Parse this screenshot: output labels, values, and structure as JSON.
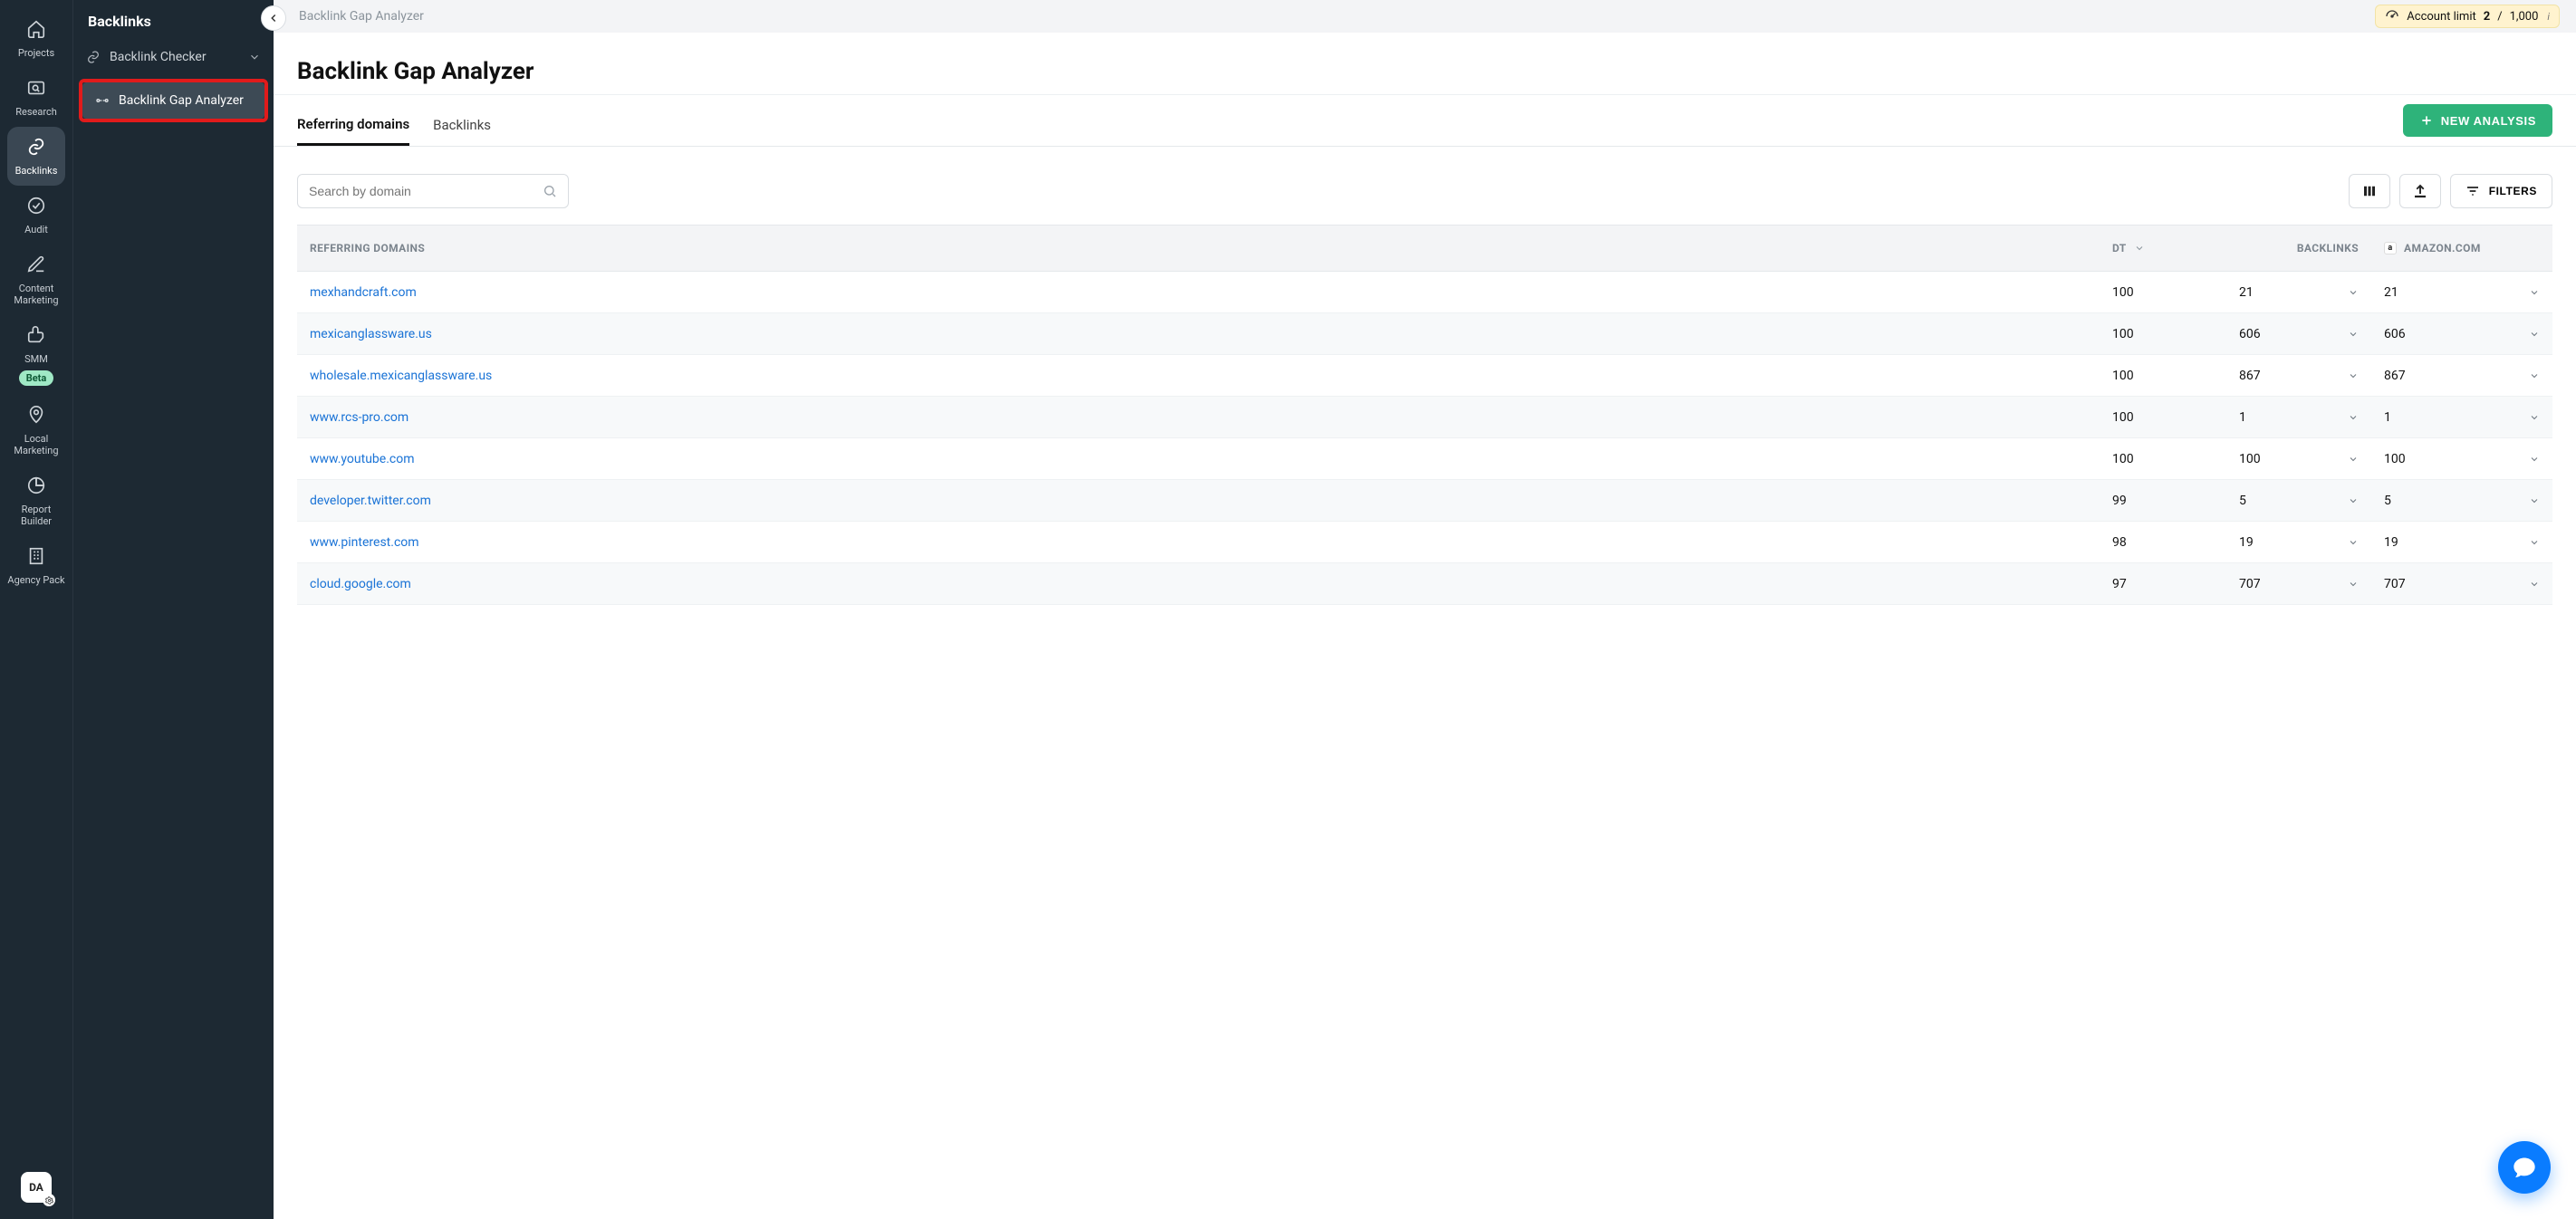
{
  "rail": [
    {
      "label": "Projects"
    },
    {
      "label": "Research"
    },
    {
      "label": "Backlinks"
    },
    {
      "label": "Audit"
    },
    {
      "label": "Content Marketing"
    },
    {
      "label": "SMM",
      "badge": "Beta"
    },
    {
      "label": "Local Marketing"
    },
    {
      "label": "Report Builder"
    },
    {
      "label": "Agency Pack"
    }
  ],
  "avatar": "DA",
  "sidebar": {
    "title": "Backlinks",
    "items": [
      {
        "label": "Backlink Checker"
      },
      {
        "label": "Backlink Gap Analyzer"
      }
    ]
  },
  "breadcrumb": "Backlink Gap Analyzer",
  "limit": {
    "label": "Account limit",
    "used": "2",
    "sep": "/",
    "total": "1,000"
  },
  "page_title": "Backlink Gap Analyzer",
  "tabs": [
    {
      "label": "Referring domains",
      "active": true
    },
    {
      "label": "Backlinks"
    }
  ],
  "new_analysis": "NEW ANALYSIS",
  "search_placeholder": "Search by domain",
  "filters_label": "FILTERS",
  "columns": {
    "c1": "REFERRING DOMAINS",
    "c2": "DT",
    "c3": "BACKLINKS",
    "c4": "AMAZON.COM"
  },
  "rows": [
    {
      "domain": "mexhandcraft.com",
      "dt": "100",
      "backlinks": "21",
      "amazon": "21"
    },
    {
      "domain": "mexicanglassware.us",
      "dt": "100",
      "backlinks": "606",
      "amazon": "606"
    },
    {
      "domain": "wholesale.mexicanglassware.us",
      "dt": "100",
      "backlinks": "867",
      "amazon": "867"
    },
    {
      "domain": "www.rcs-pro.com",
      "dt": "100",
      "backlinks": "1",
      "amazon": "1"
    },
    {
      "domain": "www.youtube.com",
      "dt": "100",
      "backlinks": "100",
      "amazon": "100"
    },
    {
      "domain": "developer.twitter.com",
      "dt": "99",
      "backlinks": "5",
      "amazon": "5"
    },
    {
      "domain": "www.pinterest.com",
      "dt": "98",
      "backlinks": "19",
      "amazon": "19"
    },
    {
      "domain": "cloud.google.com",
      "dt": "97",
      "backlinks": "707",
      "amazon": "707"
    }
  ]
}
